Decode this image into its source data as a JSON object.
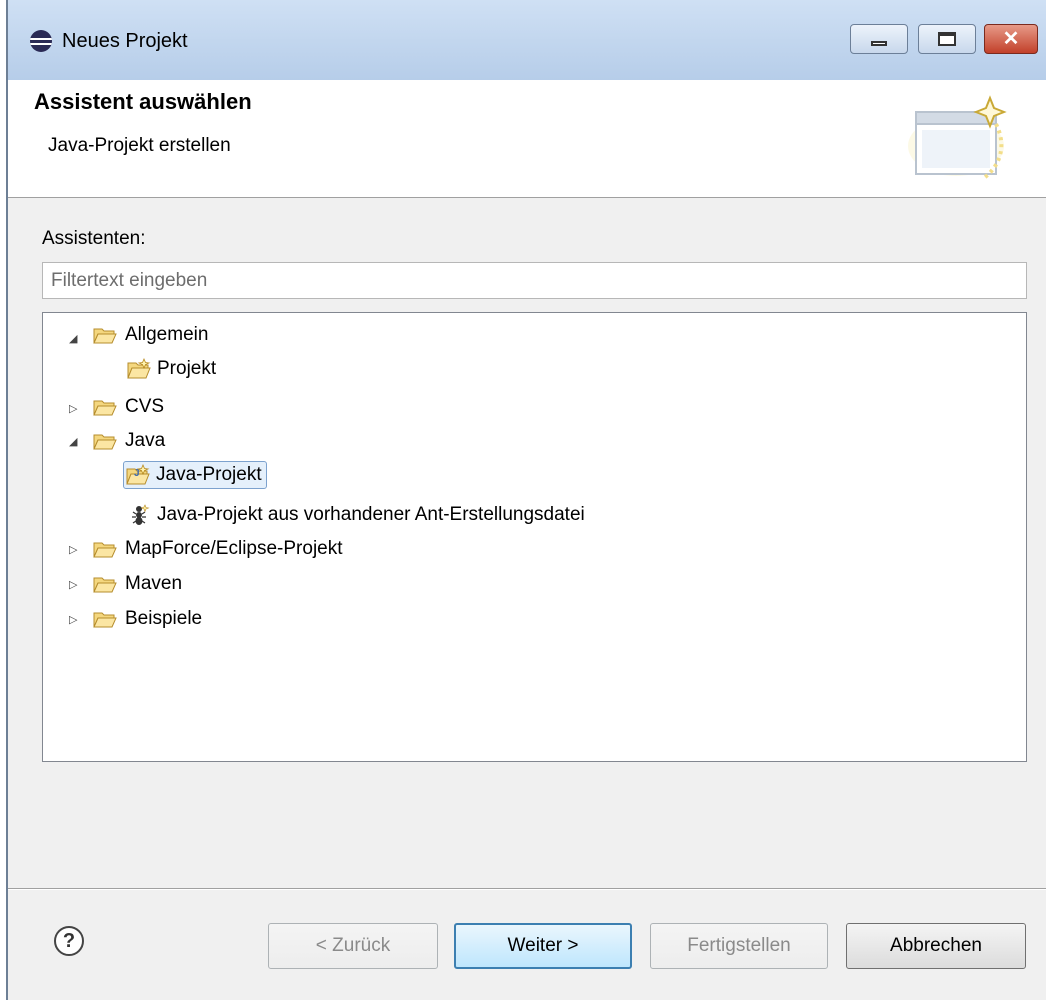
{
  "window": {
    "title": "Neues Projekt",
    "icon": "eclipse-icon"
  },
  "banner": {
    "title": "Assistent auswählen",
    "subtitle": "Java-Projekt erstellen"
  },
  "wizards": {
    "label": "Assistenten:",
    "filter_placeholder": "Filtertext eingeben",
    "tree": [
      {
        "label": "Allgemein",
        "type": "folder",
        "expanded": true
      },
      {
        "label": "Projekt",
        "type": "item",
        "icon": "project-wizard-icon"
      },
      {
        "label": "CVS",
        "type": "folder",
        "expanded": false
      },
      {
        "label": "Java",
        "type": "folder",
        "expanded": true
      },
      {
        "label": "Java-Projekt",
        "type": "item",
        "icon": "java-project-wizard-icon",
        "selected": true
      },
      {
        "label": "Java-Projekt aus vorhandener Ant-Erstellungsdatei",
        "type": "item",
        "icon": "ant-icon"
      },
      {
        "label": "MapForce/Eclipse-Projekt",
        "type": "folder",
        "expanded": false
      },
      {
        "label": "Maven",
        "type": "folder",
        "expanded": false
      },
      {
        "label": "Beispiele",
        "type": "folder",
        "expanded": false
      }
    ]
  },
  "buttons": {
    "help": "?",
    "back": "< Zurück",
    "next": "Weiter >",
    "finish": "Fertigstellen",
    "cancel": "Abbrechen"
  },
  "colors": {
    "selection_border": "#7da2ce",
    "selection_fill": "#e5f0fb",
    "folder": "#e8c15a"
  }
}
